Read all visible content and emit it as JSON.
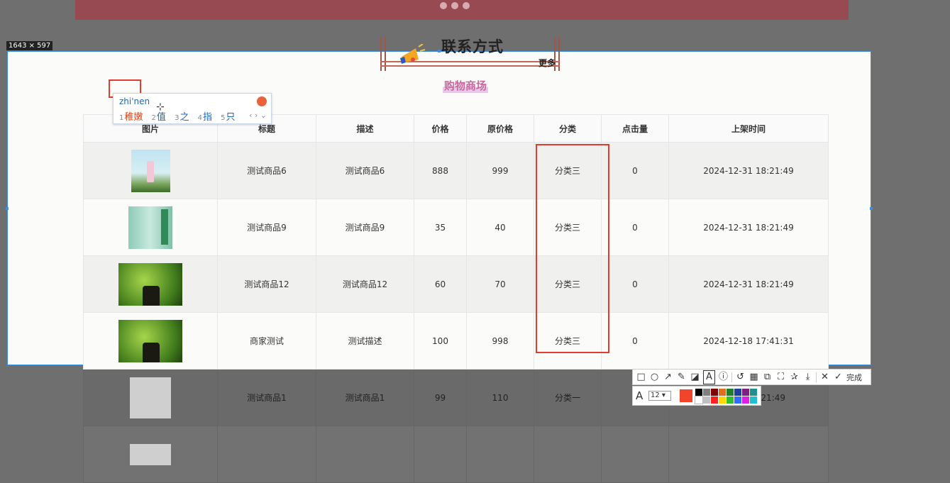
{
  "capture": {
    "dimensions_label": "1643 × 597"
  },
  "page": {
    "title": "联系方式",
    "more_label": "更多",
    "section_title": "购物商场"
  },
  "table": {
    "headers": [
      "图片",
      "标题",
      "描述",
      "价格",
      "原价格",
      "分类",
      "点击量",
      "上架时间"
    ],
    "rows": [
      {
        "title": "测试商品6",
        "desc": "测试商品6",
        "price": "888",
        "orig_price": "999",
        "category": "分类三",
        "clicks": "0",
        "time": "2024-12-31 18:21:49"
      },
      {
        "title": "测试商品9",
        "desc": "测试商品9",
        "price": "35",
        "orig_price": "40",
        "category": "分类三",
        "clicks": "0",
        "time": "2024-12-31 18:21:49"
      },
      {
        "title": "测试商品12",
        "desc": "测试商品12",
        "price": "60",
        "orig_price": "70",
        "category": "分类三",
        "clicks": "0",
        "time": "2024-12-31 18:21:49"
      },
      {
        "title": "商家测试",
        "desc": "测试描述",
        "price": "100",
        "orig_price": "998",
        "category": "分类三",
        "clicks": "0",
        "time": "2024-12-18 17:41:31"
      },
      {
        "title": "测试商品1",
        "desc": "测试商品1",
        "price": "99",
        "orig_price": "110",
        "category": "分类一",
        "clicks": "",
        "time": "21:49"
      }
    ]
  },
  "ime": {
    "pinyin": "zhi'nen",
    "candidates": [
      {
        "index": "1",
        "text": "稚嫩"
      },
      {
        "index": "2",
        "text": "值"
      },
      {
        "index": "3",
        "text": "之"
      },
      {
        "index": "4",
        "text": "指"
      },
      {
        "index": "5",
        "text": "只"
      }
    ],
    "nav": "‹ › ⌄"
  },
  "snip_toolbar": {
    "done_label": "完成",
    "font_size": "12",
    "current_color": "#f0442b",
    "palette": [
      "#000000",
      "#808080",
      "#800000",
      "#e07020",
      "#1f7f2f",
      "#1f3f9f",
      "#7f1f7f",
      "#1f8f8f",
      "#ffffff",
      "#c0c0c0",
      "#ff2020",
      "#ffd800",
      "#2fbf2f",
      "#2f6fff",
      "#e020e0",
      "#20c0d0"
    ]
  }
}
